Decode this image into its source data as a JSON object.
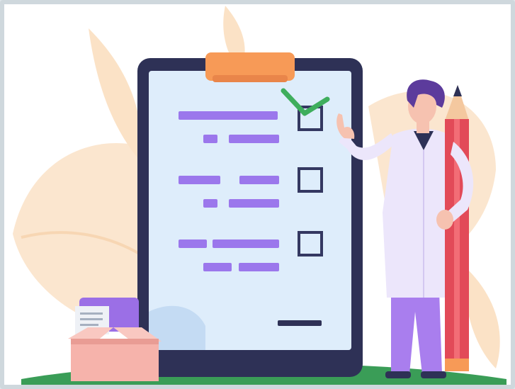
{
  "illustration": {
    "subject": "",
    "checklist": {
      "items": [
        {
          "checked": true
        },
        {
          "checked": false
        },
        {
          "checked": false
        }
      ]
    }
  },
  "colors": {
    "leaf_peach": "#fbe2c6",
    "leaf_orange": "#f8caa0",
    "clipboard_frame": "#2e3156",
    "paper": "#deedfb",
    "clip": "#f79a57",
    "text_line": "#9b77ec",
    "check": "#3fae5d",
    "checkbox": "#343861",
    "coat": "#ece6fb",
    "trousers": "#a97eee",
    "hair": "#5c3b9c",
    "skin": "#f6c2b0",
    "pencil": "#e24a58",
    "box": "#f6b3ab",
    "ground": "#3a9d57"
  }
}
